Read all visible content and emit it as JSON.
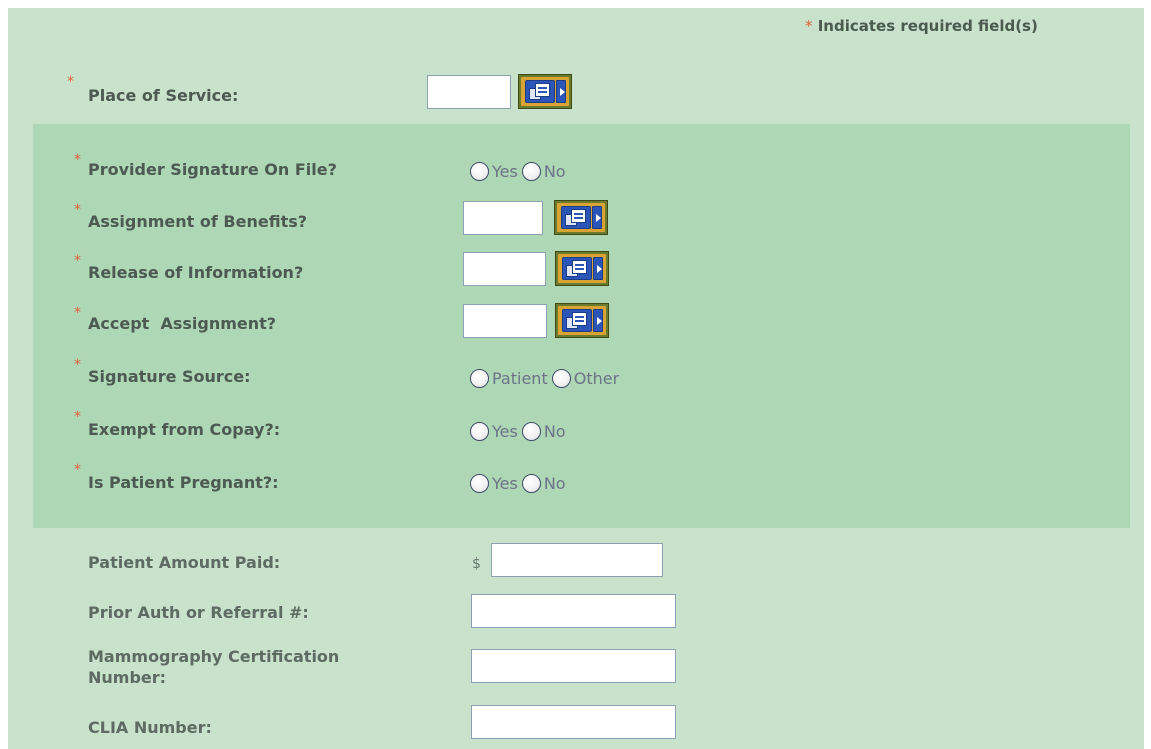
{
  "required_note": {
    "star": "*",
    "text": " Indicates required field(s)"
  },
  "place_of_service": {
    "label": "Place of Service:",
    "value": "",
    "lookup_icon": "lookup-list-icon"
  },
  "provider_signature": {
    "label": "Provider Signature On File?",
    "options": [
      "Yes",
      "No"
    ]
  },
  "assignment_of_benefits": {
    "label": "Assignment of Benefits?",
    "value": "",
    "lookup_icon": "lookup-list-icon"
  },
  "release_of_information": {
    "label": "Release of Information?",
    "value": "",
    "lookup_icon": "lookup-list-icon"
  },
  "accept_assignment": {
    "label": "Accept  Assignment?",
    "value": "",
    "lookup_icon": "lookup-list-icon"
  },
  "signature_source": {
    "label": "Signature Source:",
    "options": [
      "Patient",
      "Other"
    ]
  },
  "exempt_copay": {
    "label": "Exempt from Copay?:",
    "options": [
      "Yes",
      "No"
    ]
  },
  "patient_pregnant": {
    "label": "Is Patient Pregnant?:",
    "options": [
      "Yes",
      "No"
    ]
  },
  "patient_amount_paid": {
    "label": "Patient Amount Paid:",
    "currency": "$",
    "value": ""
  },
  "prior_auth": {
    "label": "Prior Auth or Referral #:",
    "value": ""
  },
  "mammography": {
    "label_line1": "Mammography Certification",
    "label_line2": "Number:",
    "value": ""
  },
  "clia": {
    "label": "CLIA Number:",
    "value": ""
  },
  "required_star": "*",
  "colors": {
    "background": "#c9e2cc",
    "band": "#aed7b6",
    "required": "#e0613a",
    "label": "#4c5a52"
  }
}
